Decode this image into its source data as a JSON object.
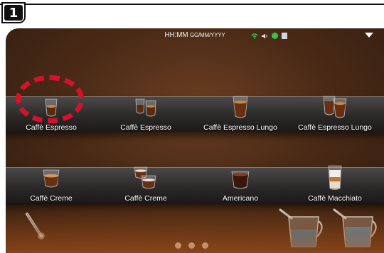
{
  "step": {
    "number": "1"
  },
  "status_bar": {
    "time": "HH:MM",
    "date": "GG/MM/YYYY",
    "icons": [
      "wifi-icon",
      "speaker-icon",
      "status-dot-icon",
      "device-icon"
    ]
  },
  "drinks": [
    {
      "label": "Caffè Espresso",
      "cup": "espresso",
      "highlighted": true
    },
    {
      "label": "Caffè Espresso",
      "cup": "double-espresso"
    },
    {
      "label": "Caffè Espresso Lungo",
      "cup": "lungo"
    },
    {
      "label": "Caffè Espresso Lungo",
      "cup": "double-lungo"
    },
    {
      "label": "Caffè Creme",
      "cup": "creme"
    },
    {
      "label": "Caffè Creme",
      "cup": "double-creme"
    },
    {
      "label": "Americano",
      "cup": "americano"
    },
    {
      "label": "Caffè Macchiato",
      "cup": "macchiato"
    }
  ],
  "pagination": {
    "pages": 3
  },
  "colors": {
    "highlight": "#d8112b",
    "status_green": "#36c24a",
    "screen_brown": "#4a2a16"
  }
}
